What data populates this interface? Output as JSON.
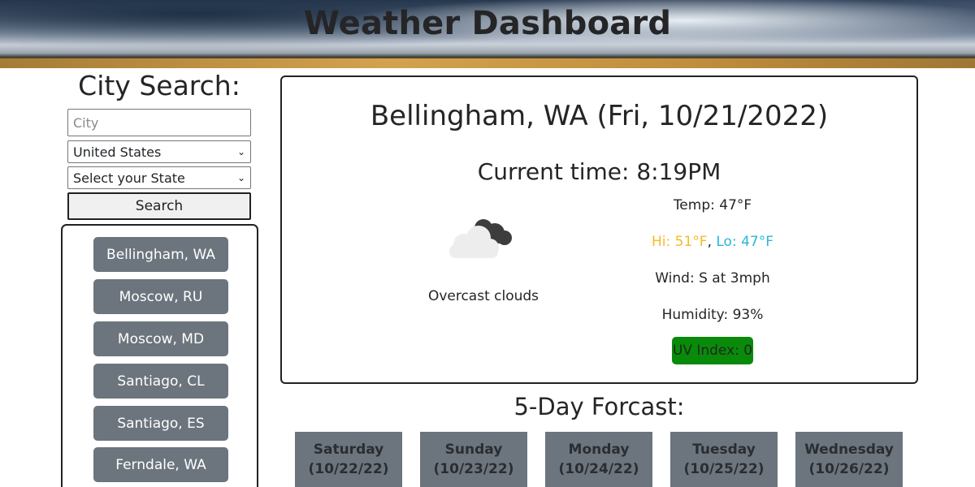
{
  "header": {
    "title": "Weather Dashboard"
  },
  "search": {
    "title": "City Search:",
    "city_placeholder": "City",
    "country_selected": "United States",
    "state_selected": "Select your State",
    "button_label": "Search"
  },
  "history": [
    {
      "label": "Bellingham, WA"
    },
    {
      "label": "Moscow, RU"
    },
    {
      "label": "Moscow, MD"
    },
    {
      "label": "Santiago, CL"
    },
    {
      "label": "Santiago, ES"
    },
    {
      "label": "Ferndale, WA"
    }
  ],
  "current": {
    "city_date": "Bellingham, WA (Fri, 10/21/2022)",
    "time": "Current time: 8:19PM",
    "icon": "overcast-clouds-icon",
    "condition": "Overcast clouds",
    "temp": "Temp: 47°F",
    "hi": "Hi: 51°F",
    "sep": ", ",
    "lo": "Lo: 47°F",
    "wind": "Wind: S at 3mph",
    "humidity": "Humidity: 93%",
    "uv": "UV Index: 0"
  },
  "forecast": {
    "title": "5-Day Forcast:",
    "days": [
      {
        "day": "Saturday",
        "date": "(10/22/22)"
      },
      {
        "day": "Sunday",
        "date": "(10/23/22)"
      },
      {
        "day": "Monday",
        "date": "(10/24/22)"
      },
      {
        "day": "Tuesday",
        "date": "(10/25/22)"
      },
      {
        "day": "Wednesday",
        "date": "(10/26/22)"
      }
    ]
  },
  "colors": {
    "history_button": "#6c757d",
    "hi_text": "#f5b92b",
    "lo_text": "#29b6d8",
    "uv_badge": "#0a8a0a"
  }
}
